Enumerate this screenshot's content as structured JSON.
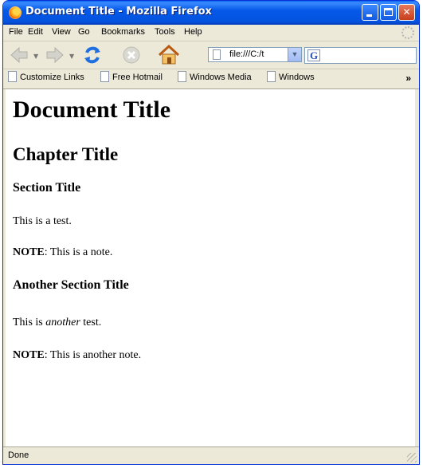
{
  "window": {
    "title": "Document Title - Mozilla Firefox"
  },
  "menu": {
    "items": [
      "File",
      "Edit",
      "View",
      "Go",
      "Bookmarks",
      "Tools",
      "Help"
    ]
  },
  "navigation": {
    "url": "file:///C:/t",
    "search_engine_glyph": "G"
  },
  "bookmarks": {
    "items": [
      "Customize Links",
      "Free Hotmail",
      "Windows Media",
      "Windows"
    ],
    "overflow": "»"
  },
  "page": {
    "h1": "Document Title",
    "chapter": "Chapter Title",
    "section1": {
      "title": "Section Title",
      "text": "This is a test.",
      "note_label": "NOTE",
      "note_text": ": This is a note."
    },
    "section2": {
      "title": "Another Section Title",
      "text_pre": "This is ",
      "text_em": "another",
      "text_post": " test.",
      "note_label": "NOTE",
      "note_text": ": This is another note."
    }
  },
  "status": {
    "text": "Done"
  },
  "colors": {
    "titlebar": "#0558e8",
    "chrome": "#ece9d8",
    "close_button": "#c73e1b"
  }
}
